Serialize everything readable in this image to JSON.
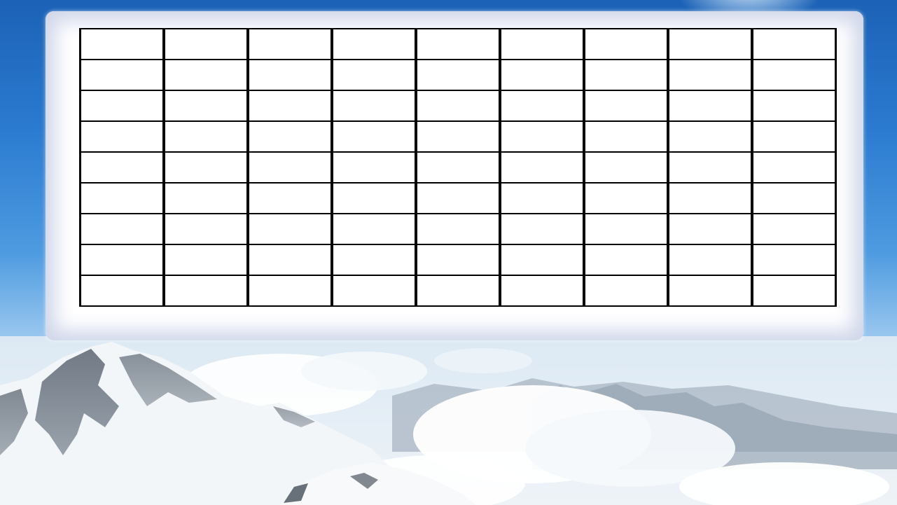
{
  "background": {
    "sky_top_color": "#1c62b6",
    "sky_mid_color": "#4e9be0",
    "horizon_color": "#cfe3f3",
    "scene": "snowy-mountains-above-clouds"
  },
  "panel": {
    "fill_color": "#ffffff",
    "inner_glow_color": "#cdd4e8"
  },
  "grid": {
    "rows": 9,
    "columns": 9,
    "line_color": "#000000",
    "cells": [
      [
        "",
        "",
        "",
        "",
        "",
        "",
        "",
        "",
        ""
      ],
      [
        "",
        "",
        "",
        "",
        "",
        "",
        "",
        "",
        ""
      ],
      [
        "",
        "",
        "",
        "",
        "",
        "",
        "",
        "",
        ""
      ],
      [
        "",
        "",
        "",
        "",
        "",
        "",
        "",
        "",
        ""
      ],
      [
        "",
        "",
        "",
        "",
        "",
        "",
        "",
        "",
        ""
      ],
      [
        "",
        "",
        "",
        "",
        "",
        "",
        "",
        "",
        ""
      ],
      [
        "",
        "",
        "",
        "",
        "",
        "",
        "",
        "",
        ""
      ],
      [
        "",
        "",
        "",
        "",
        "",
        "",
        "",
        "",
        ""
      ],
      [
        "",
        "",
        "",
        "",
        "",
        "",
        "",
        "",
        ""
      ]
    ]
  }
}
